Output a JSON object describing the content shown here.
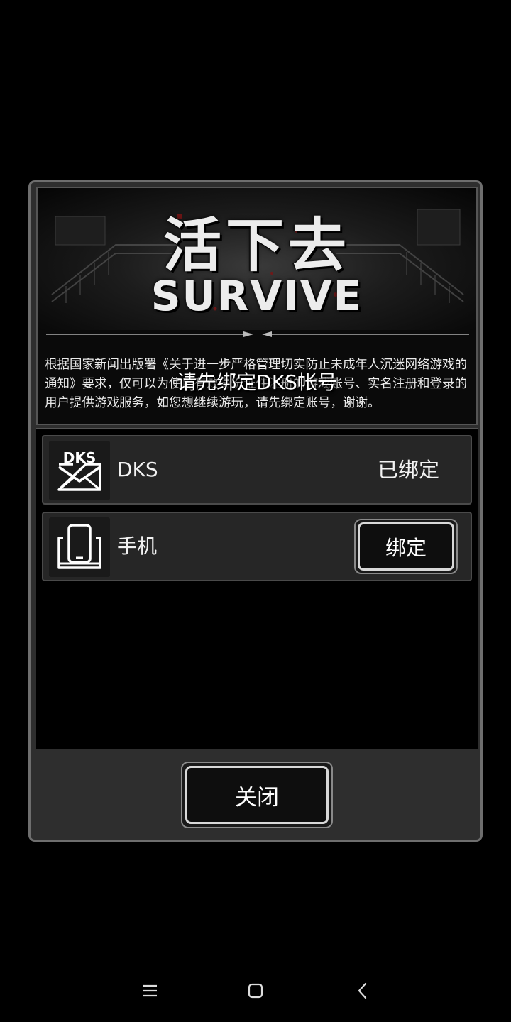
{
  "banner": {
    "logo_cn": "活下去",
    "logo_en": "SURVIVE"
  },
  "notice": {
    "text": "根据国家新闻出版署《关于进一步严格管理切实防止未成年人沉迷网络游戏的通知》要求，仅可以为使用有效身份证件注册的游戏账号、实名注册和登录的用户提供游戏服务，如您想继续游玩，请先绑定账号，谢谢。",
    "overlay_title": "请先绑定DKS帐号"
  },
  "accounts": [
    {
      "icon": "dks-mail-icon",
      "icon_text": "DKS",
      "label": "DKS",
      "status": "已绑定"
    },
    {
      "icon": "phone-icon",
      "label": "手机",
      "button": "绑定"
    }
  ],
  "footer": {
    "close_label": "关闭"
  },
  "navbar": {
    "menu": "menu-icon",
    "home": "home-icon",
    "back": "back-icon"
  }
}
